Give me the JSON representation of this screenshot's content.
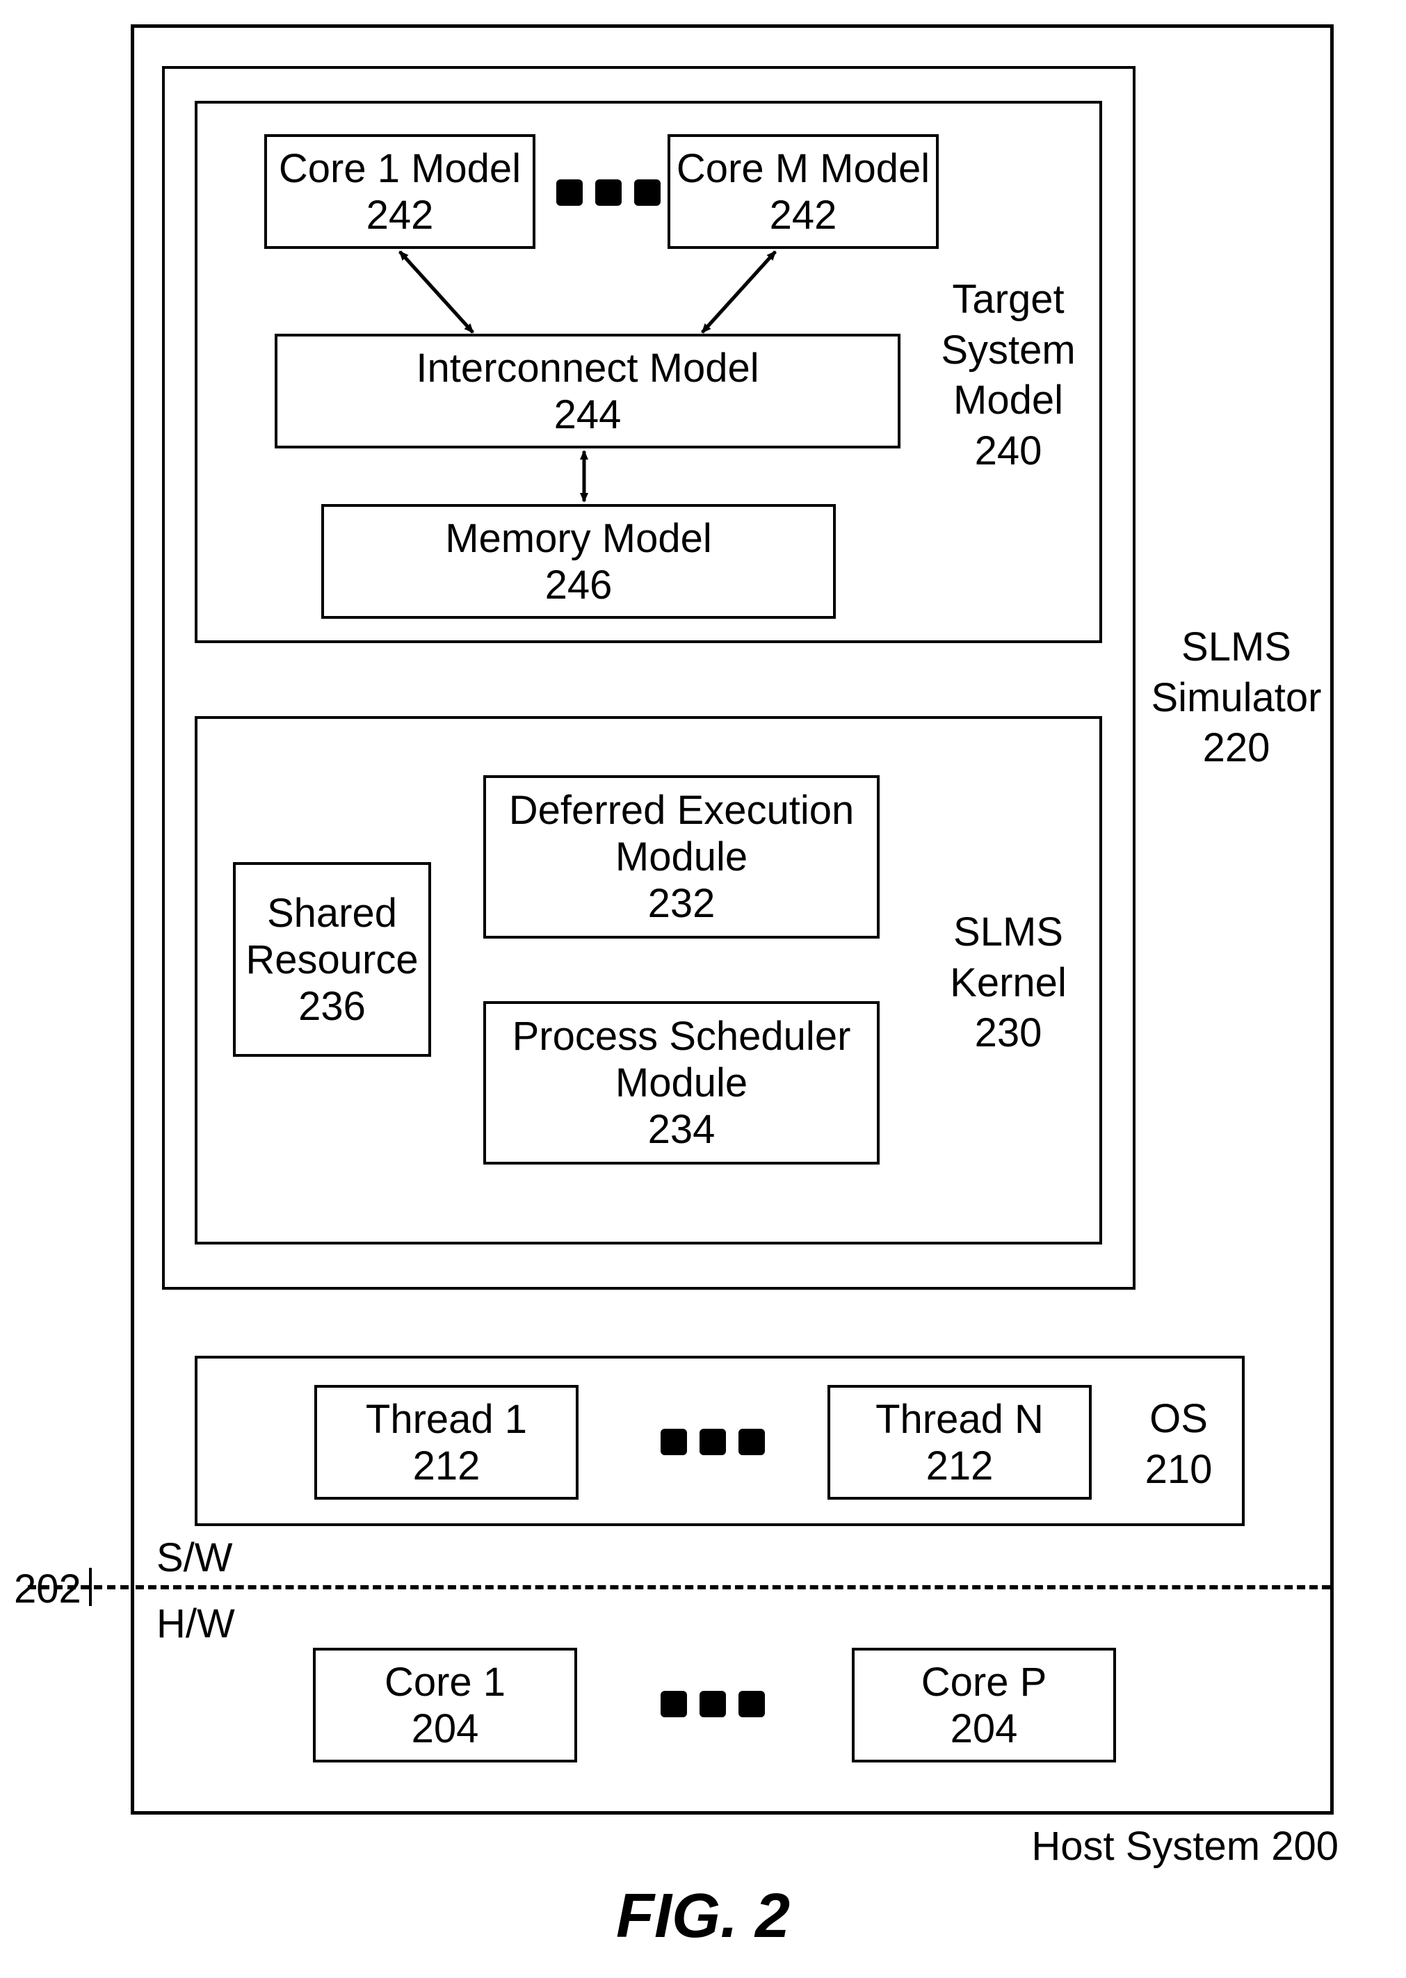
{
  "fig_caption": "FIG. 2",
  "host_system": {
    "title": "Host System 200"
  },
  "ref_202": "202",
  "sw_label": "S/W",
  "hw_label": "H/W",
  "os": {
    "label_line1": "OS",
    "label_line2": "210"
  },
  "thread1": {
    "line1": "Thread 1",
    "line2": "212"
  },
  "threadN": {
    "line1": "Thread N",
    "line2": "212"
  },
  "core1hw": {
    "line1": "Core 1",
    "line2": "204"
  },
  "corePhw": {
    "line1": "Core P",
    "line2": "204"
  },
  "slms_sim": {
    "line1": "SLMS",
    "line2": "Simulator",
    "line3": "220"
  },
  "slms_kernel": {
    "line1": "SLMS",
    "line2": "Kernel",
    "line3": "230"
  },
  "shared_resource": {
    "line1": "Shared",
    "line2": "Resource",
    "line3": "236"
  },
  "deferred_exec": {
    "line1": "Deferred Execution",
    "line2": "Module",
    "line3": "232"
  },
  "proc_sched": {
    "line1": "Process Scheduler",
    "line2": "Module",
    "line3": "234"
  },
  "target_model": {
    "line1": "Target",
    "line2": "System",
    "line3": "Model",
    "line4": "240"
  },
  "core1_model": {
    "line1": "Core 1 Model",
    "line2": "242"
  },
  "coreM_model": {
    "line1": "Core M Model",
    "line2": "242"
  },
  "interconnect_model": {
    "line1": "Interconnect Model",
    "line2": "244"
  },
  "memory_model": {
    "line1": "Memory Model",
    "line2": "246"
  }
}
